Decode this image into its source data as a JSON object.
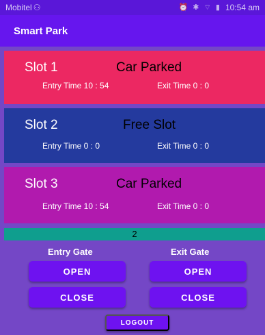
{
  "status_bar": {
    "carrier": "Mobitel",
    "time": "10:54 am"
  },
  "app_bar": {
    "title": "Smart Park"
  },
  "slots": [
    {
      "name": "Slot 1",
      "status": "Car Parked",
      "entry": "Entry Time 10 : 54",
      "exit": "Exit Time   0 : 0"
    },
    {
      "name": "Slot 2",
      "status": "Free Slot",
      "entry": "Entry Time   0 : 0",
      "exit": "Exit Time   0 : 0"
    },
    {
      "name": "Slot 3",
      "status": "Car Parked",
      "entry": "Entry Time 10 : 54",
      "exit": "Exit Time   0 : 0"
    }
  ],
  "counter": "2",
  "gates": {
    "entry_label": "Entry Gate",
    "exit_label": "Exit Gate",
    "open_label": "OPEN",
    "close_label": "CLOSE"
  },
  "logout_label": "LOGOUT",
  "colors": {
    "app_bar": "#6616ee",
    "slot1": "#ec2862",
    "slot2": "#243a9e",
    "slot3": "#b11aae",
    "counter": "#0f9e8e",
    "button": "#6e12f0",
    "background": "#7447c6"
  }
}
